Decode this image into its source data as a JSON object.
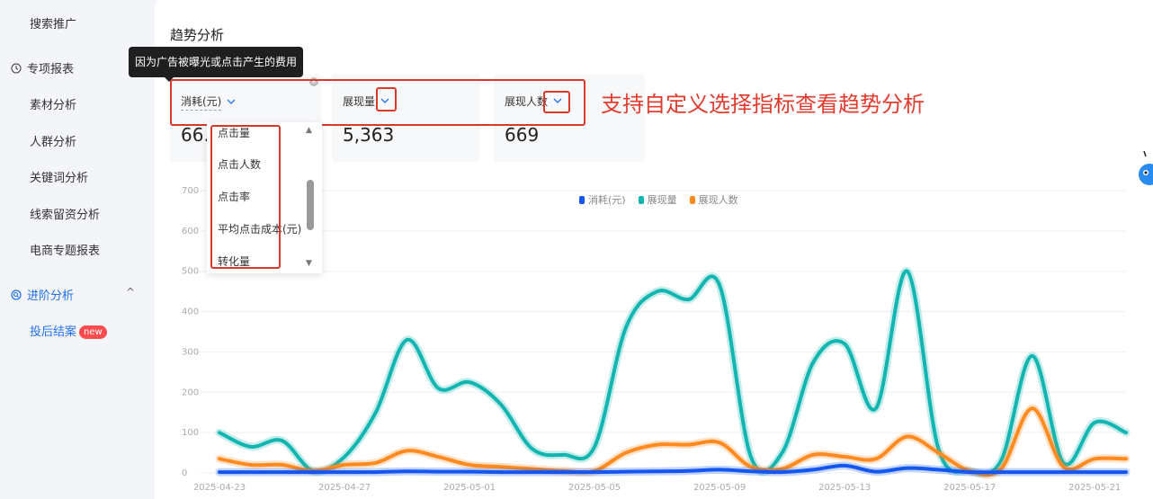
{
  "sidebar": {
    "items": [
      {
        "label": "搜索推广"
      },
      {
        "label": "专项报表",
        "group": true
      },
      {
        "label": "素材分析"
      },
      {
        "label": "人群分析"
      },
      {
        "label": "关键词分析"
      },
      {
        "label": "线索留资分析"
      },
      {
        "label": "电商专题报表"
      },
      {
        "label": "进阶分析",
        "group": true,
        "caret": "^"
      },
      {
        "label": "投后结案",
        "badge": "new"
      }
    ]
  },
  "main": {
    "section_title": "趋势分析",
    "tooltip": "因为广告被曝光或点击产生的费用",
    "annotation": "支持自定义选择指标查看趋势分析",
    "metrics": [
      {
        "label": "消耗(元)",
        "value": "66.1"
      },
      {
        "label": "展现量",
        "value": "5,363"
      },
      {
        "label": "展现人数",
        "value": "669"
      }
    ],
    "dropdown": {
      "options": [
        "点击量",
        "点击人数",
        "点击率",
        "平均点击成本(元)",
        "转化量"
      ]
    }
  },
  "chart_data": {
    "type": "line",
    "smooth": true,
    "legend_position": "top-center",
    "grid": true,
    "ylim": [
      0,
      700
    ],
    "yticks": [
      0,
      100,
      200,
      300,
      400,
      500,
      600,
      700
    ],
    "x": [
      "2025-04-23",
      "2025-04-24",
      "2025-04-25",
      "2025-04-26",
      "2025-04-27",
      "2025-04-28",
      "2025-04-29",
      "2025-04-30",
      "2025-05-01",
      "2025-05-02",
      "2025-05-03",
      "2025-05-04",
      "2025-05-05",
      "2025-05-06",
      "2025-05-07",
      "2025-05-08",
      "2025-05-09",
      "2025-05-10",
      "2025-05-11",
      "2025-05-12",
      "2025-05-13",
      "2025-05-14",
      "2025-05-15",
      "2025-05-16",
      "2025-05-17",
      "2025-05-18",
      "2025-05-19",
      "2025-05-20",
      "2025-05-21",
      "2025-05-22"
    ],
    "xtick_labels": [
      "2025-04-23",
      "2025-04-27",
      "2025-05-01",
      "2025-05-05",
      "2025-05-09",
      "2025-05-13",
      "2025-05-17",
      "2025-05-21"
    ],
    "series": [
      {
        "name": "消耗(元)",
        "color": "#1456f0",
        "values": [
          2,
          2,
          2,
          2,
          2,
          2,
          4,
          3,
          3,
          2,
          2,
          2,
          2,
          3,
          4,
          5,
          8,
          4,
          2,
          8,
          18,
          3,
          12,
          8,
          2,
          2,
          2,
          2,
          2,
          2
        ]
      },
      {
        "name": "展现量",
        "color": "#12b5b0",
        "values": [
          100,
          65,
          80,
          5,
          40,
          150,
          330,
          210,
          225,
          170,
          60,
          45,
          65,
          360,
          450,
          430,
          465,
          40,
          50,
          275,
          320,
          160,
          500,
          60,
          5,
          30,
          290,
          25,
          125,
          100
        ]
      },
      {
        "name": "展现人数",
        "color": "#ff8a1f",
        "values": [
          35,
          20,
          20,
          5,
          20,
          25,
          55,
          40,
          20,
          15,
          10,
          5,
          5,
          50,
          70,
          70,
          75,
          15,
          10,
          45,
          40,
          35,
          90,
          50,
          5,
          10,
          160,
          15,
          35,
          35
        ]
      }
    ]
  }
}
